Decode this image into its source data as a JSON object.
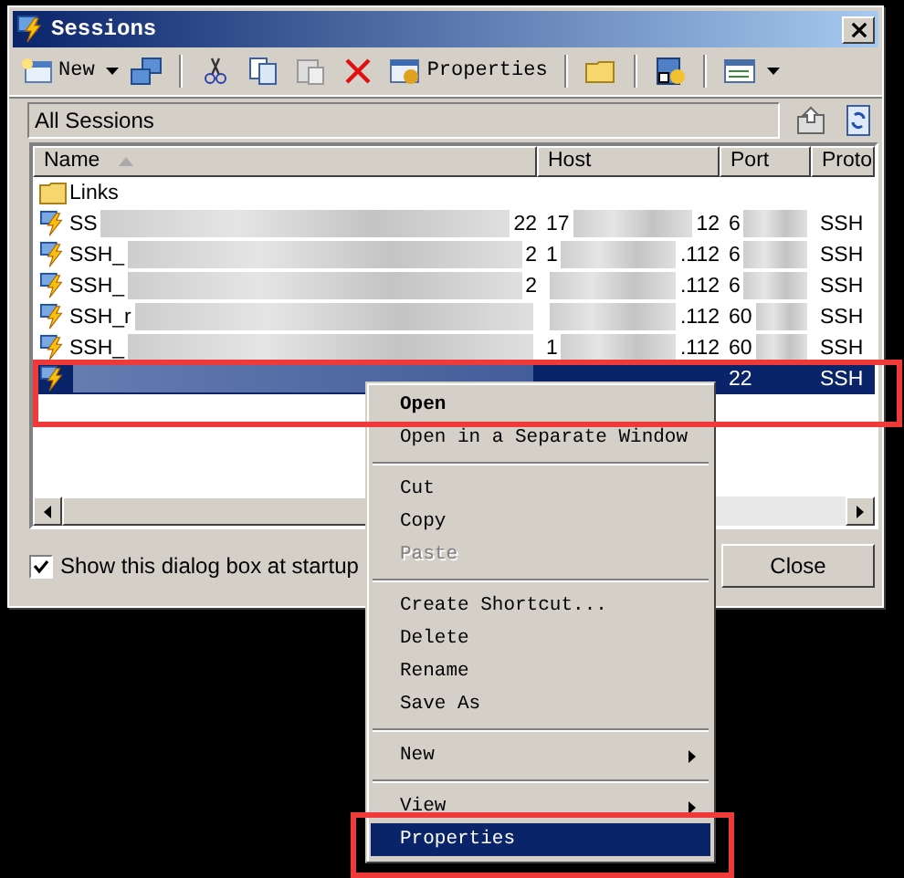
{
  "window": {
    "title": "Sessions"
  },
  "toolbar": [
    {
      "kind": "new",
      "label": "New"
    },
    {
      "kind": "dropdown"
    },
    {
      "kind": "connect"
    },
    {
      "kind": "separator"
    },
    {
      "kind": "cut"
    },
    {
      "kind": "copy"
    },
    {
      "kind": "paste"
    },
    {
      "kind": "delete"
    },
    {
      "kind": "properties",
      "label": "Properties"
    },
    {
      "kind": "separator"
    },
    {
      "kind": "folder"
    },
    {
      "kind": "separator"
    },
    {
      "kind": "shortcut"
    },
    {
      "kind": "separator"
    },
    {
      "kind": "view"
    },
    {
      "kind": "dropdown"
    }
  ],
  "address": {
    "value": "All Sessions"
  },
  "columns": [
    {
      "label": "Name",
      "sorted": true
    },
    {
      "label": "Host",
      "sorted": false
    },
    {
      "label": "Port",
      "sorted": false
    },
    {
      "label": "Proto",
      "sorted": false
    }
  ],
  "rows": [
    {
      "kind": "folder",
      "name": "Links",
      "selected": false
    },
    {
      "kind": "session",
      "name": "SS",
      "name_end": "22",
      "host": "17",
      "host_end": "12",
      "port": "6",
      "proto": "SSH",
      "selected": false
    },
    {
      "kind": "session",
      "name": "SSH_",
      "name_end": "2",
      "host": "1",
      "host_end": ".112",
      "port": "6",
      "proto": "SSH",
      "selected": false
    },
    {
      "kind": "session",
      "name": "SSH_",
      "name_end": "2",
      "host_end": ".112",
      "port": "6",
      "proto": "SSH",
      "selected": false
    },
    {
      "kind": "session",
      "name": "SSH_r",
      "host_end": ".112",
      "port": "60",
      "proto": "SSH",
      "selected": false
    },
    {
      "kind": "session",
      "name": "SSH_",
      "host": "1",
      "host_end": ".112",
      "port": "60",
      "proto": "SSH",
      "selected": false
    },
    {
      "kind": "session",
      "port": "22",
      "proto": "SSH",
      "selected": true
    }
  ],
  "startup_checkbox": {
    "label": "Show this dialog box at startup",
    "checked": true
  },
  "close_button": {
    "label": "Close"
  },
  "context_menu": [
    {
      "kind": "item",
      "label": "Open",
      "default": true,
      "disabled": false,
      "submenu": false,
      "selected": false
    },
    {
      "kind": "item",
      "label": "Open in a Separate Window",
      "default": false,
      "disabled": false,
      "submenu": false,
      "selected": false
    },
    {
      "kind": "separator"
    },
    {
      "kind": "item",
      "label": "Cut",
      "default": false,
      "disabled": false,
      "submenu": false,
      "selected": false
    },
    {
      "kind": "item",
      "label": "Copy",
      "default": false,
      "disabled": false,
      "submenu": false,
      "selected": false
    },
    {
      "kind": "item",
      "label": "Paste",
      "default": false,
      "disabled": true,
      "submenu": false,
      "selected": false
    },
    {
      "kind": "separator"
    },
    {
      "kind": "item",
      "label": "Create Shortcut...",
      "default": false,
      "disabled": false,
      "submenu": false,
      "selected": false
    },
    {
      "kind": "item",
      "label": "Delete",
      "default": false,
      "disabled": false,
      "submenu": false,
      "selected": false
    },
    {
      "kind": "item",
      "label": "Rename",
      "default": false,
      "disabled": false,
      "submenu": false,
      "selected": false
    },
    {
      "kind": "item",
      "label": "Save As",
      "default": false,
      "disabled": false,
      "submenu": false,
      "selected": false
    },
    {
      "kind": "separator"
    },
    {
      "kind": "item",
      "label": "New",
      "default": false,
      "disabled": false,
      "submenu": true,
      "selected": false
    },
    {
      "kind": "separator"
    },
    {
      "kind": "item",
      "label": "View",
      "default": false,
      "disabled": false,
      "submenu": true,
      "selected": false
    },
    {
      "kind": "item",
      "label": "Properties",
      "default": false,
      "disabled": false,
      "submenu": false,
      "selected": true
    }
  ],
  "annotations": [
    {
      "kind": "red-frame"
    },
    {
      "kind": "red-frame"
    }
  ]
}
